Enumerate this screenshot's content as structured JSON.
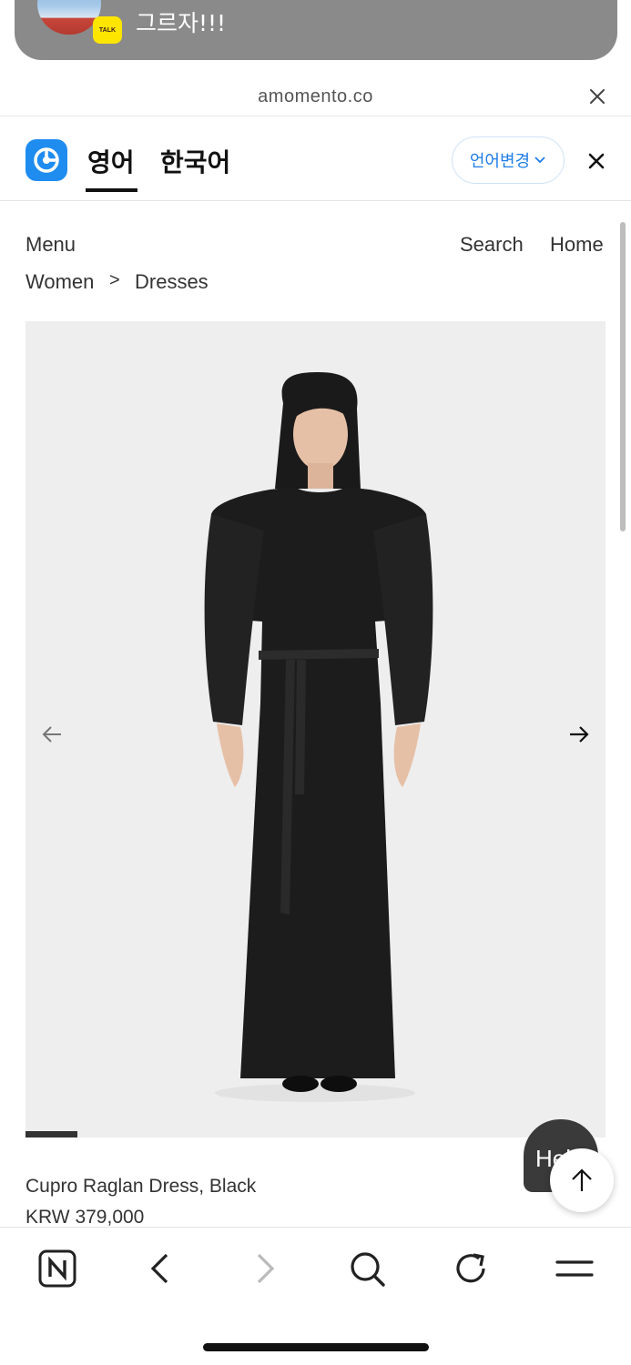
{
  "notification": {
    "app_badge": "TALK",
    "message": "그르자!!!"
  },
  "url_bar": {
    "domain": "amomento.co"
  },
  "translate_bar": {
    "source_lang": "영어",
    "target_lang": "한국어",
    "change_language_label": "언어변경"
  },
  "site_nav": {
    "menu_label": "Menu",
    "search_label": "Search",
    "home_label": "Home",
    "breadcrumb": [
      "Women",
      ">",
      "Dresses"
    ]
  },
  "product": {
    "name": "Cupro Raglan Dress, Black",
    "price": "KRW 379,000",
    "gallery_progress": 0.09
  },
  "help_button_label": "Help",
  "icons": {
    "prev_image": "arrow-left-icon",
    "next_image": "arrow-right-icon",
    "scroll_top": "arrow-up-icon",
    "toolbar": [
      "naver-home-icon",
      "back-icon",
      "forward-icon",
      "search-icon",
      "reload-icon",
      "menu-icon"
    ]
  },
  "colors": {
    "translate_accent": "#1f8cf0",
    "kakao_yellow": "#fee500",
    "dress": "#1c1c1c"
  }
}
